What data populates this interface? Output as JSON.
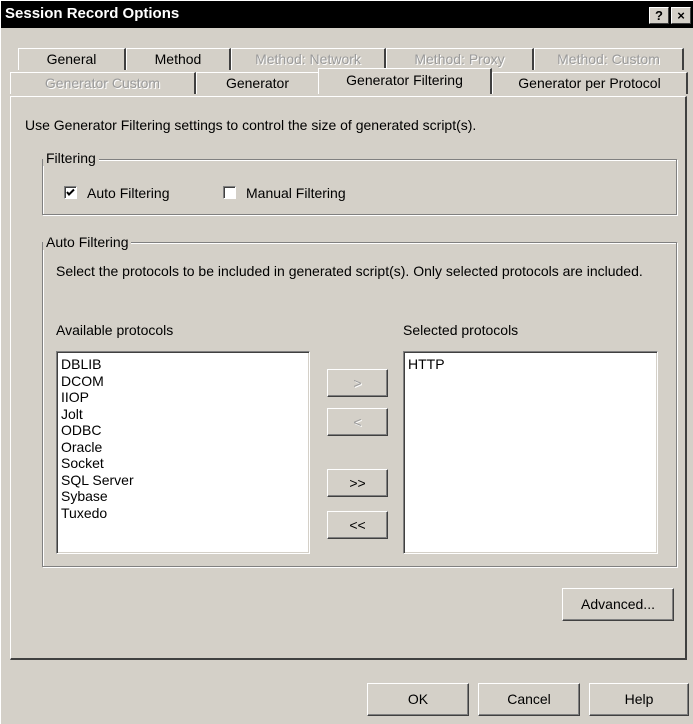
{
  "window": {
    "title": "Session Record Options",
    "help_button": "?",
    "close_button": "×"
  },
  "tabs": {
    "row1": [
      {
        "label": "General",
        "enabled": true
      },
      {
        "label": "Method",
        "enabled": true
      },
      {
        "label": "Method: Network",
        "enabled": false
      },
      {
        "label": "Method: Proxy",
        "enabled": false
      },
      {
        "label": "Method: Custom",
        "enabled": false
      }
    ],
    "row2": [
      {
        "label": "Generator Custom",
        "enabled": false
      },
      {
        "label": "Generator",
        "enabled": true
      },
      {
        "label": "Generator Filtering",
        "enabled": true,
        "active": true
      },
      {
        "label": "Generator per Protocol",
        "enabled": true
      }
    ]
  },
  "panel": {
    "description": "Use Generator Filtering settings to control the size of generated script(s).",
    "filtering_group": {
      "legend": "Filtering",
      "auto_label": "Auto Filtering",
      "auto_checked": true,
      "manual_label": "Manual Filtering",
      "manual_checked": false
    },
    "auto_group": {
      "legend": "Auto Filtering",
      "instructions": "Select the protocols to be included in generated script(s).  Only selected protocols are included.",
      "available_label": "Available protocols",
      "selected_label": "Selected protocols",
      "available": [
        "DBLIB",
        "DCOM",
        "IIOP",
        "Jolt",
        "ODBC",
        "Oracle",
        "Socket",
        "SQL Server",
        "Sybase",
        "Tuxedo"
      ],
      "selected": [
        "HTTP"
      ],
      "add_label": ">",
      "remove_label": "<",
      "add_all_label": ">>",
      "remove_all_label": "<<"
    },
    "advanced_label": "Advanced..."
  },
  "footer": {
    "ok_label": "OK",
    "cancel_label": "Cancel",
    "help_label": "Help"
  }
}
